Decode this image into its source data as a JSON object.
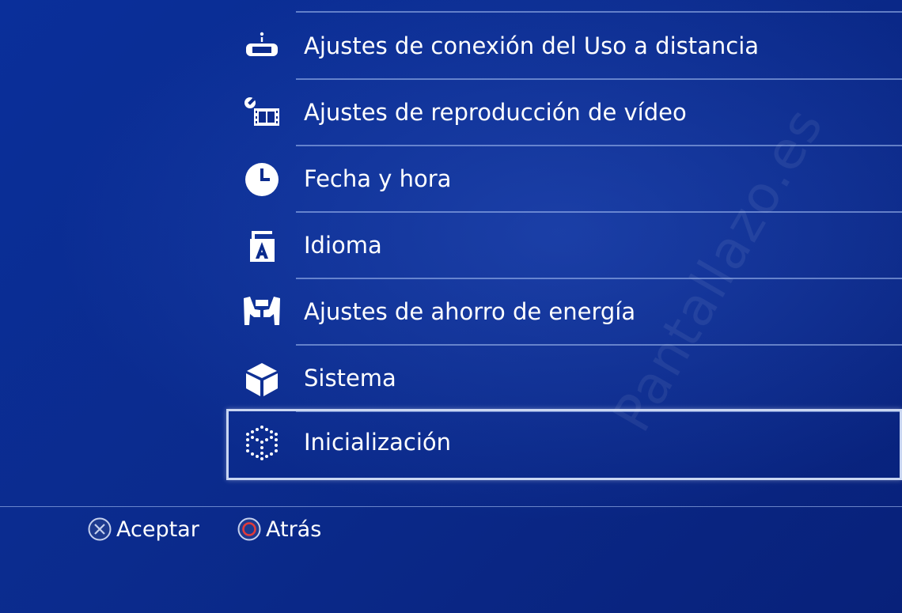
{
  "menu": {
    "items": [
      {
        "label": "Ajustes de conexión del Uso a distancia",
        "icon": "remote-play-vita-icon"
      },
      {
        "label": "Ajustes de reproducción de vídeo",
        "icon": "video-wrench-icon"
      },
      {
        "label": "Fecha y hora",
        "icon": "clock-icon"
      },
      {
        "label": "Idioma",
        "icon": "language-icon"
      },
      {
        "label": "Ajustes de ahorro de energía",
        "icon": "power-save-icon"
      },
      {
        "label": "Sistema",
        "icon": "cube-icon"
      },
      {
        "label": "Inicialización",
        "icon": "dotted-cube-icon"
      }
    ],
    "selected_index": 6
  },
  "footer": {
    "accept_label": "Aceptar",
    "back_label": "Atrás"
  },
  "watermark": "Pantallazo.es",
  "colors": {
    "background": "#0b2b8d",
    "text": "#ffffff",
    "separator": "#aac3f5",
    "selection_border": "#c9d6f2",
    "circle_button": "#e03a3a"
  }
}
